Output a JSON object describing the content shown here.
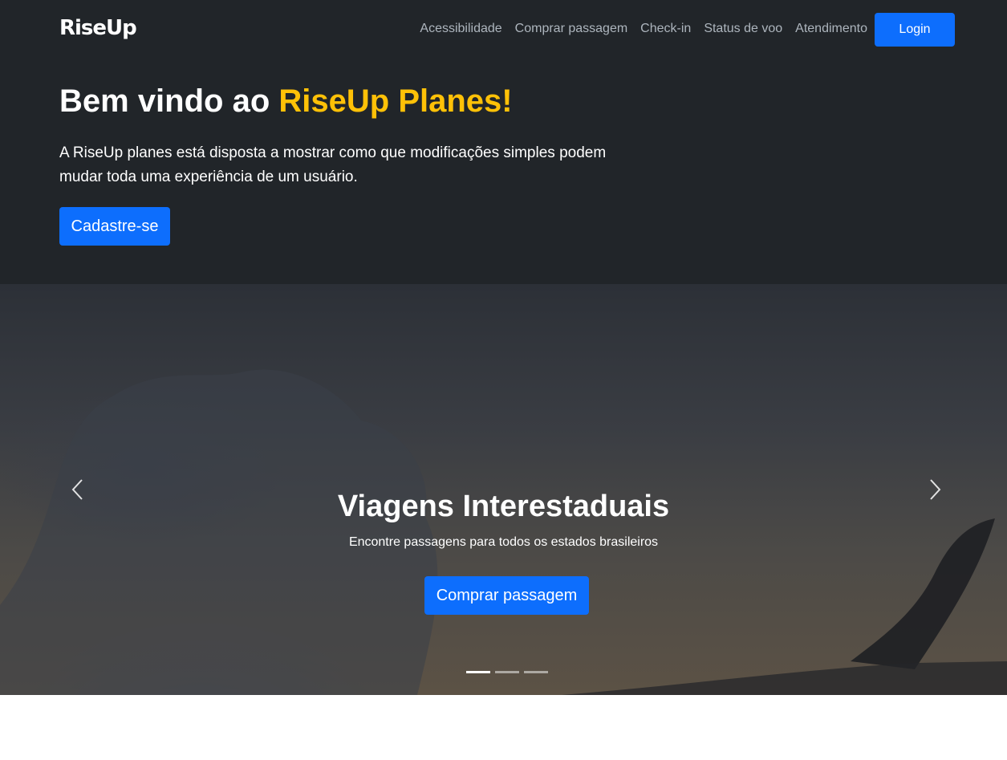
{
  "navbar": {
    "brand": "RiseUp",
    "links": [
      "Acessibilidade",
      "Comprar passagem",
      "Check-in",
      "Status de voo",
      "Atendimento"
    ],
    "login_label": "Login"
  },
  "hero": {
    "title_prefix": "Bem vindo ao ",
    "title_accent": "RiseUp Planes!",
    "description": "A RiseUp planes está disposta a mostrar como que modificações simples podem mudar toda uma experiência de um usuário.",
    "cta_label": "Cadastre-se"
  },
  "carousel": {
    "caption_title": "Viagens Interestaduais",
    "caption_text": "Encontre passagens para todos os estados brasileiros",
    "button_label": "Comprar passagem",
    "slide_count": 3,
    "active_slide": 1
  },
  "colors": {
    "primary": "#0d6efd",
    "accent": "#ffc107",
    "dark": "#212529"
  }
}
